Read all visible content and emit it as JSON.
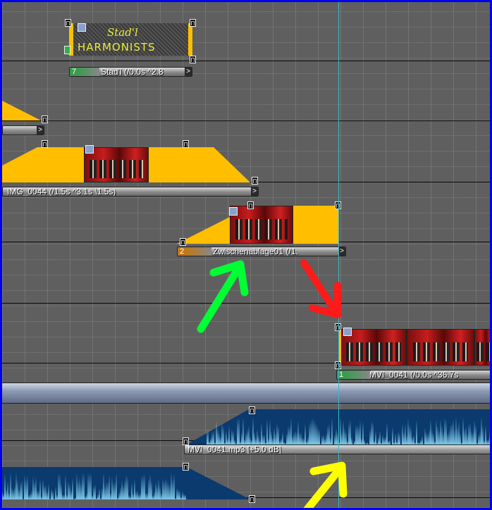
{
  "title_clip": {
    "text_line1": "Stad'l",
    "text_line2": "HARMONISTS",
    "track_number": "7",
    "label": "Stad'l (/0.0s ^2.8"
  },
  "clip_a": {
    "end_button": ">"
  },
  "clip_img": {
    "label": "IMG_0044 (/1.5s ^3.1s \\1.5s)",
    "end_button": ">"
  },
  "clip_zw": {
    "track_number": "2",
    "label": "Zwischenablage01 (/1.",
    "end_button": ">"
  },
  "clip_mvi": {
    "track_number": "1",
    "label": "MVI_0041 (/0.0s ^36.7s"
  },
  "audio_clip": {
    "label": "MVI_0041.mp3 [+5.0 dB]"
  },
  "handle_glyph": "П",
  "colors": {
    "border": "#0000ee",
    "background": "#5f5f5f",
    "fade_yellow": "#ffbf00",
    "audio_dark": "#0a3a6e",
    "audio_light": "#7ec8e6",
    "playhead": "#3fb8c8",
    "arrow_green": "#00ff33",
    "arrow_red": "#ff1a1a",
    "arrow_yellow": "#ffff00"
  }
}
